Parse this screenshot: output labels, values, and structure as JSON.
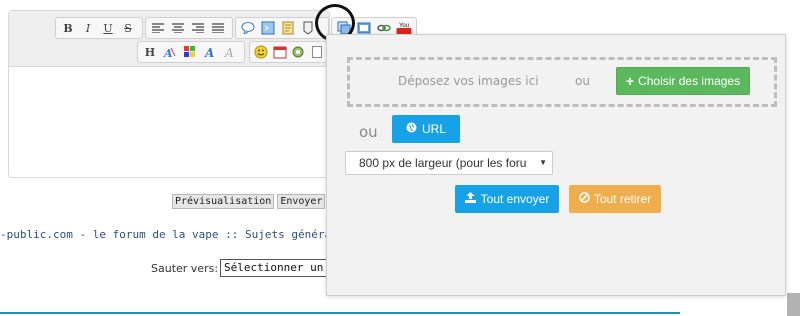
{
  "toolbar": {
    "row1_format": [
      {
        "name": "bold-button",
        "icon": "bold-icon",
        "glyph": "B"
      },
      {
        "name": "italic-button",
        "icon": "italic-icon",
        "glyph": "I"
      },
      {
        "name": "underline-button",
        "icon": "underline-icon",
        "glyph": "U"
      },
      {
        "name": "strike-button",
        "icon": "strikethrough-icon",
        "glyph": "S"
      }
    ],
    "row2_text": [
      {
        "name": "heading-button",
        "icon": "heading-icon",
        "glyph": "H"
      }
    ],
    "youtube_label": "You"
  },
  "form": {
    "preview_label": "Prévisualisation",
    "send_label": "Envoyer"
  },
  "forum_breadcrumb": "-public.com - le forum de la vape :: Sujets généraux sur l",
  "jump": {
    "label": "Sauter vers:",
    "selected": "Sélectionner un fo"
  },
  "upload": {
    "dropzone_text": "Déposez vos images ici",
    "dropzone_or": "ou",
    "choose_label": "Choisir des images",
    "or_label": "ou",
    "url_label": "URL",
    "size_selected": "800 px de largeur (pour les foru",
    "send_all_label": "Tout envoyer",
    "remove_all_label": "Tout retirer",
    "colors": {
      "green": "#5cb85c",
      "blue": "#17a2e8",
      "orange": "#f0ad4e"
    }
  }
}
